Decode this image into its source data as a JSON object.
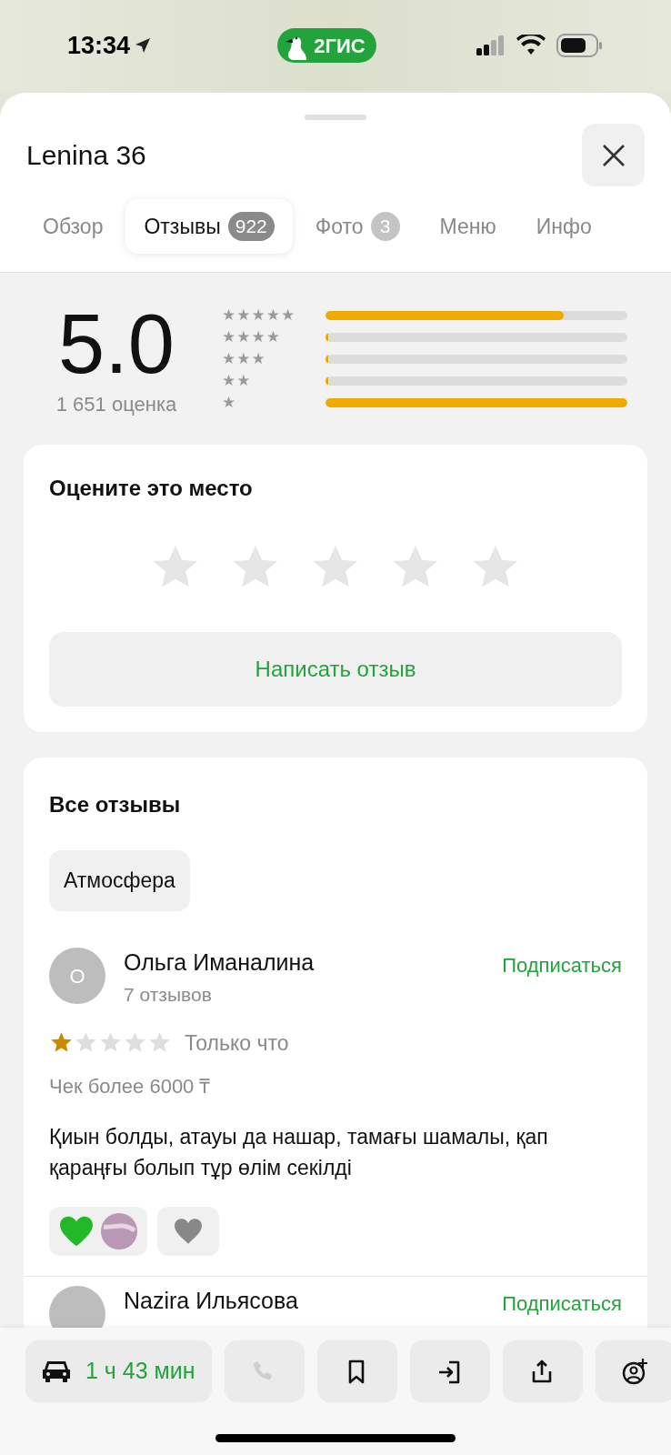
{
  "status_bar": {
    "time": "13:34",
    "app_badge": "2ГИС"
  },
  "sheet": {
    "title": "Lenina 36",
    "tabs": [
      {
        "label": "Обзор",
        "selected": false
      },
      {
        "label": "Отзывы",
        "count": "922",
        "selected": true
      },
      {
        "label": "Фото",
        "count": "3",
        "selected": false
      },
      {
        "label": "Меню",
        "selected": false
      },
      {
        "label": "Инфо",
        "selected": false
      }
    ]
  },
  "rating": {
    "score": "5.0",
    "count": "1 651 оценка",
    "distribution": [
      {
        "label": "★★★★★",
        "level": 0.79
      },
      {
        "label": "★★★★",
        "level": 0.008
      },
      {
        "label": "★★★",
        "level": 0.008
      },
      {
        "label": "★★",
        "level": 0.008
      },
      {
        "label": "★",
        "level": 1
      }
    ]
  },
  "rate_card": {
    "title": "Оцените это место",
    "stars": 0,
    "button": "Написать отзыв"
  },
  "reviews_card": {
    "title": "Все отзывы",
    "filters": [
      {
        "label": "Атмосфера"
      }
    ],
    "reviews": [
      {
        "avatar": "О",
        "name": "Ольга Иманалина",
        "count": "7 отзывов",
        "subscribe": "Подписаться",
        "stars": 1,
        "time": "Только что",
        "check": "Чек более 6000 ₸",
        "text": "Қиын болды, атауы да нашар, тамағы шамалы, қап қараңғы болып тұр өлім секілді"
      },
      {
        "name": "Nazira Ильясова",
        "subscribe": "Подписаться"
      }
    ]
  },
  "bottom_bar": {
    "route": "1 ч 43 мин",
    "actions": [
      {
        "kind": "call",
        "disabled": true
      },
      {
        "kind": "bookmark",
        "disabled": false
      },
      {
        "kind": "enter",
        "disabled": false
      },
      {
        "kind": "share",
        "disabled": false
      },
      {
        "kind": "add-contact",
        "disabled": false
      }
    ]
  }
}
